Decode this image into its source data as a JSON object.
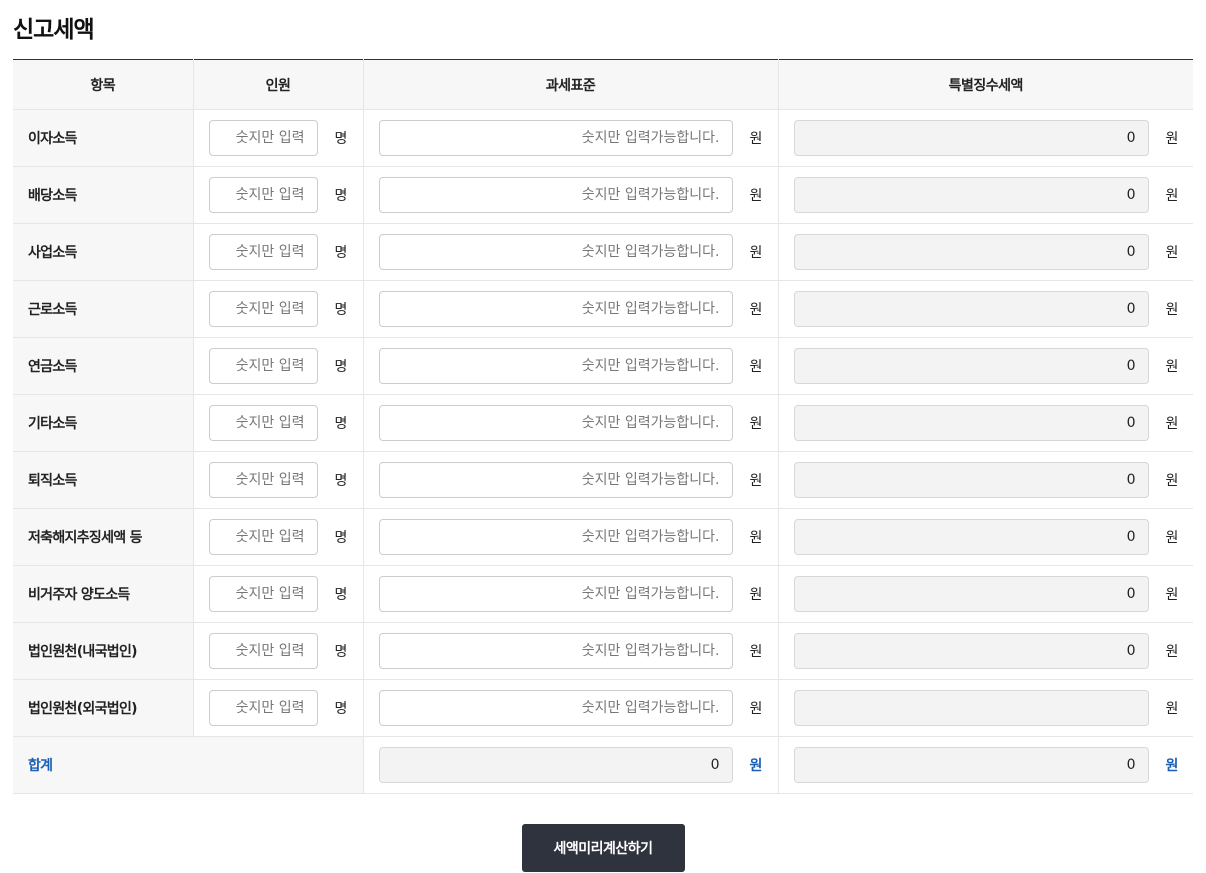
{
  "page": {
    "title": "신고세액"
  },
  "table": {
    "headers": {
      "item": "항목",
      "persons": "인원",
      "tax_base": "과세표준",
      "special_tax": "특별징수세액"
    },
    "person_placeholder": "숫지만 입력",
    "base_placeholder": "숫지만 입력가능합니다.",
    "unit_person": "명",
    "unit_won": "원",
    "rows": [
      {
        "label": "이자소득",
        "tax_value": "0"
      },
      {
        "label": "배당소득",
        "tax_value": "0"
      },
      {
        "label": "사업소득",
        "tax_value": "0"
      },
      {
        "label": "근로소득",
        "tax_value": "0"
      },
      {
        "label": "연금소득",
        "tax_value": "0"
      },
      {
        "label": "기타소득",
        "tax_value": "0"
      },
      {
        "label": "퇴직소득",
        "tax_value": "0"
      },
      {
        "label": "저축해지추징세액 등",
        "tax_value": "0"
      },
      {
        "label": "비거주자 양도소득",
        "tax_value": "0"
      },
      {
        "label": "법인원천(내국법인)",
        "tax_value": "0"
      },
      {
        "label": "법인원천(외국법인)",
        "tax_value": ""
      }
    ],
    "total": {
      "label": "합계",
      "base_value": "0",
      "tax_value": "0"
    }
  },
  "button": {
    "label": "세액미리계산하기"
  },
  "colors": {
    "total_accent": "#1a5fb4",
    "button_bg": "#2f333d",
    "readonly_bg": "#f3f3f3"
  }
}
